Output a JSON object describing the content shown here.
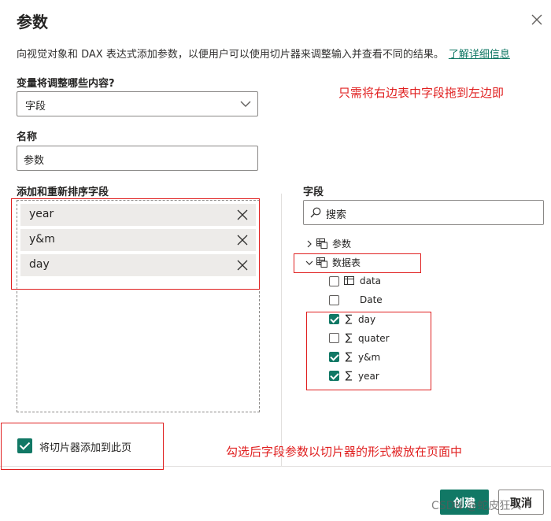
{
  "dialog": {
    "title": "参数",
    "description": "向视觉对象和 DAX 表达式添加参数，以便用户可以使用切片器来调整输入并查看不同的结果。",
    "learn_more": "了解详细信息"
  },
  "variable": {
    "label": "变量将调整哪些内容?",
    "selected": "字段"
  },
  "name": {
    "label": "名称",
    "value": "参数"
  },
  "add_fields": {
    "label": "添加和重新排序字段",
    "items": [
      "year",
      "y&m",
      "day"
    ]
  },
  "fields_pane": {
    "label": "字段",
    "search_placeholder": "搜索",
    "tables": [
      {
        "name": "参数",
        "expanded": false
      },
      {
        "name": "数据表",
        "expanded": true
      }
    ],
    "columns": [
      {
        "name": "data",
        "checked": false,
        "icon": "table-icon"
      },
      {
        "name": "Date",
        "checked": false,
        "icon": "none"
      },
      {
        "name": "day",
        "checked": true,
        "icon": "sigma-icon"
      },
      {
        "name": "quater",
        "checked": false,
        "icon": "sigma-icon"
      },
      {
        "name": "y&m",
        "checked": true,
        "icon": "sigma-icon"
      },
      {
        "name": "year",
        "checked": true,
        "icon": "sigma-icon"
      }
    ]
  },
  "slicer": {
    "label": "将切片器添加到此页",
    "checked": true
  },
  "buttons": {
    "create": "创建",
    "cancel": "取消"
  },
  "annotations": {
    "top": "只需将右边表中字段拖到左边即",
    "bottom": "勾选后字段参数以切片器的形式被放在页面中"
  },
  "watermark": "CSDN @蛇皮狂人",
  "colors": {
    "accent": "#117865",
    "annotation": "#e02020"
  }
}
